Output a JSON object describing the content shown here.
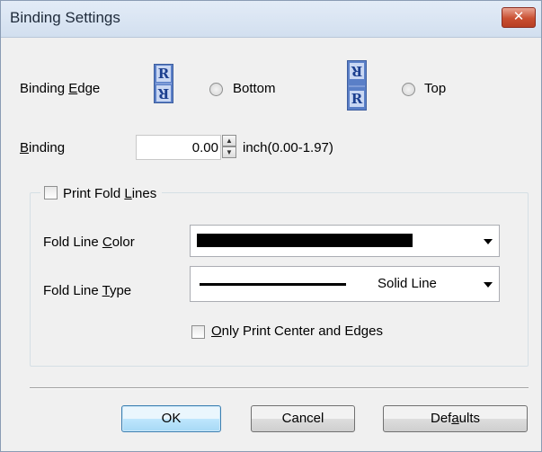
{
  "window": {
    "title": "Binding Settings",
    "close_label": "✕"
  },
  "binding_edge": {
    "label_prefix": "Binding ",
    "label_access": "E",
    "label_rest": "dge",
    "options": [
      {
        "name": "bottom",
        "label": "Bottom",
        "icon_top": "R",
        "icon_bottom": "R",
        "selected": false
      },
      {
        "name": "top",
        "label": "Top",
        "icon_top": "R",
        "icon_bottom": "R",
        "selected": false
      }
    ]
  },
  "binding": {
    "label_access": "B",
    "label_rest": "inding",
    "value": "0.00",
    "unit_range": "inch(0.00-1.97)"
  },
  "fold_group": {
    "checkbox_prefix": "Print Fold ",
    "checkbox_access": "L",
    "checkbox_rest": "ines",
    "checked": false,
    "color": {
      "label_prefix": "Fold Line ",
      "label_access": "C",
      "label_rest": "olor",
      "selected_swatch": "#000000"
    },
    "type": {
      "label_prefix": "Fold Line ",
      "label_access": "T",
      "label_rest": "ype",
      "selected_value": "Solid Line"
    },
    "center_edges": {
      "label_access": "O",
      "label_rest": "nly Print Center and Edges",
      "checked": false
    }
  },
  "buttons": {
    "ok": "OK",
    "cancel": "Cancel",
    "defaults_prefix": "Def",
    "defaults_access": "a",
    "defaults_rest": "ults"
  }
}
